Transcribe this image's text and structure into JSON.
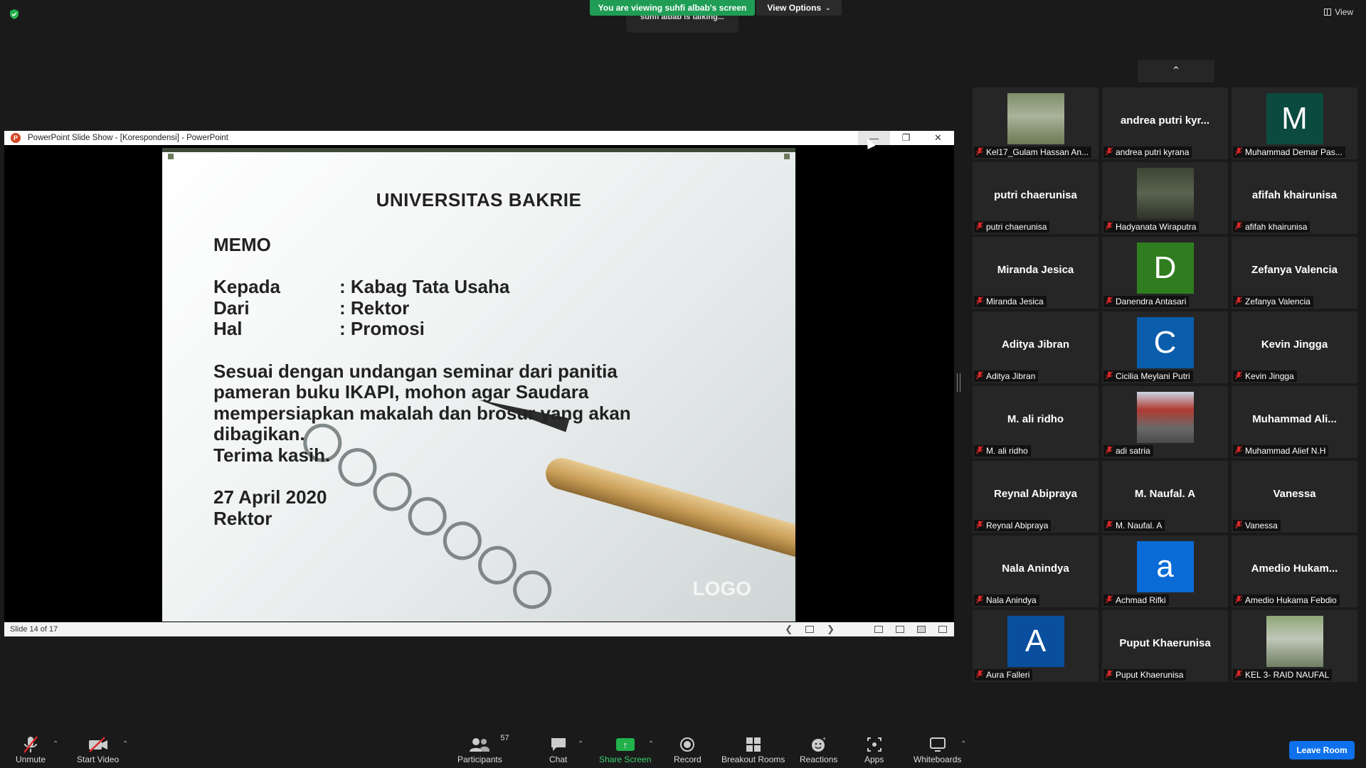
{
  "top": {
    "viewing_banner": "You are viewing suhfi albab's screen",
    "view_options": "View Options",
    "talking": "suhfi albab is talking...",
    "view": "View"
  },
  "ppt": {
    "title": "PowerPoint Slide Show - [Korespondensi] - PowerPoint",
    "status": "Slide 14 of 17",
    "slide": {
      "title": "UNIVERSITAS BAKRIE",
      "memo": "MEMO",
      "kepada_label": "Kepada",
      "kepada_value": ": Kabag Tata Usaha",
      "dari_label": "Dari",
      "dari_value": ": Rektor",
      "hal_label": "Hal",
      "hal_value": ": Promosi",
      "body1": "Sesuai dengan undangan seminar dari panitia",
      "body2": "pameran buku IKAPI, mohon agar Saudara",
      "body3": "mempersiapkan makalah dan brosur yang akan",
      "body4": "dibagikan.",
      "body5": "Terima kasih.",
      "date": "27 April 2020",
      "sign": "Rektor",
      "logo": "LOGO"
    }
  },
  "participants": [
    {
      "name": "",
      "caption": "Kel17_Gulam Hassan An...",
      "type": "photo",
      "photo": "outdoor"
    },
    {
      "name": "andrea  putri  kyr...",
      "caption": "andrea putri kyrana",
      "type": "name"
    },
    {
      "name": "",
      "caption": "Muhammad Demar Pas...",
      "type": "avatar",
      "letter": "M",
      "color": "#0b4a3e"
    },
    {
      "name": "putri chaerunisa",
      "caption": "putri chaerunisa",
      "type": "name"
    },
    {
      "name": "",
      "caption": "Hadyanata Wiraputra",
      "type": "photo",
      "photo": "dark"
    },
    {
      "name": "afifah khairunisa",
      "caption": "afifah khairunisa",
      "type": "name"
    },
    {
      "name": "Miranda Jesica",
      "caption": "Miranda Jesica",
      "type": "name"
    },
    {
      "name": "",
      "caption": "Danendra Antasari",
      "type": "avatar",
      "letter": "D",
      "color": "#2f7d1e"
    },
    {
      "name": "Zefanya Valencia",
      "caption": "Zefanya Valencia",
      "type": "name"
    },
    {
      "name": "Aditya Jibran",
      "caption": "Aditya Jibran",
      "type": "name"
    },
    {
      "name": "",
      "caption": "Cicilia Meylani Putri",
      "type": "avatar",
      "letter": "C",
      "color": "#0a5dab"
    },
    {
      "name": "Kevin Jingga",
      "caption": "Kevin Jingga",
      "type": "name"
    },
    {
      "name": "M. ali ridho",
      "caption": "M. ali ridho",
      "type": "name"
    },
    {
      "name": "",
      "caption": "adi satria",
      "type": "photo",
      "photo": "street"
    },
    {
      "name": "Muhammad  Ali...",
      "caption": "Muhammad Alief N.H",
      "type": "name"
    },
    {
      "name": "Reynal Abipraya",
      "caption": "Reynal Abipraya",
      "type": "name"
    },
    {
      "name": "M. Naufal. A",
      "caption": "M. Naufal. A",
      "type": "name"
    },
    {
      "name": "Vanessa",
      "caption": "Vanessa",
      "type": "name"
    },
    {
      "name": "Nala Anindya",
      "caption": "Nala Anindya",
      "type": "name"
    },
    {
      "name": "",
      "caption": "Achmad Rifki",
      "type": "avatar",
      "letter": "a",
      "color": "#0a6bd6"
    },
    {
      "name": "Amedio  Hukam...",
      "caption": "Amedio Hukama Febdio",
      "type": "name"
    },
    {
      "name": "",
      "caption": "Aura Falleri",
      "type": "avatar",
      "letter": "A",
      "color": "#0a4f9e"
    },
    {
      "name": "Puput Khaerunisa",
      "caption": "Puput Khaerunisa",
      "type": "name"
    },
    {
      "name": "",
      "caption": "KEL 3- RAID NAUFAL",
      "type": "photo",
      "photo": "road"
    }
  ],
  "toolbar": {
    "unmute": "Unmute",
    "start_video": "Start Video",
    "participants": "Participants",
    "participants_count": "57",
    "chat": "Chat",
    "share_screen": "Share Screen",
    "record": "Record",
    "breakout_rooms": "Breakout Rooms",
    "reactions": "Reactions",
    "apps": "Apps",
    "whiteboards": "Whiteboards",
    "leave_room": "Leave Room"
  },
  "colors": {
    "accent_green": "#1f9d55",
    "leave_blue": "#0e71eb",
    "mute_red": "#e02828"
  }
}
